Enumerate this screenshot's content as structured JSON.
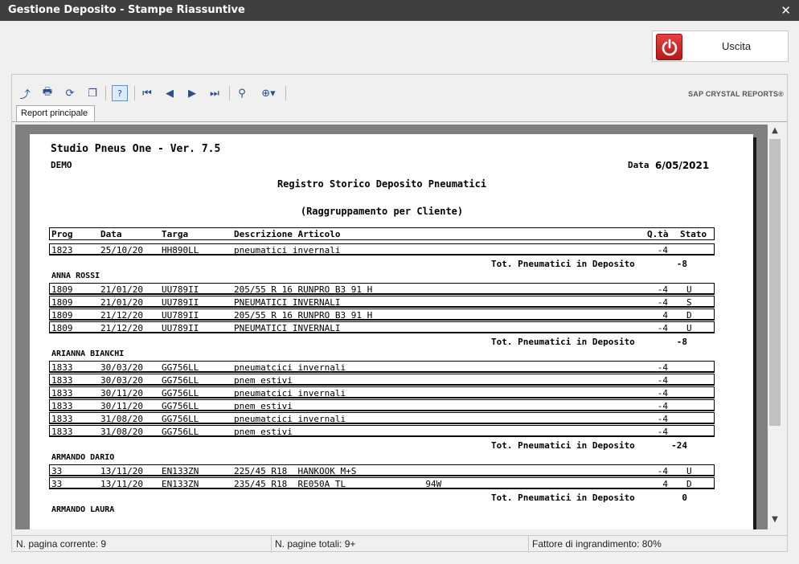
{
  "window": {
    "title": "Gestione Deposito - Stampe Riassuntive",
    "close_glyph": "✕"
  },
  "exit_button": {
    "label": "Uscita",
    "icon": "power-icon",
    "color": "#d42a2a"
  },
  "toolbar": {
    "brand": "SAP CRYSTAL REPORTS®",
    "help_label": "?"
  },
  "tabs": [
    {
      "label": "Report principale"
    }
  ],
  "report": {
    "app_line": "Studio Pneus One - Ver. 7.5",
    "company": "DEMO",
    "date_label": "Data",
    "date_value": "6/05/2021",
    "title": "Registro Storico Deposito Pneumatici",
    "subtitle": "(Raggruppamento per Cliente)",
    "columns": {
      "prog": "Prog",
      "data": "Data",
      "targa": "Targa",
      "descr": "Descrizione Articolo",
      "qta": "Q.tà",
      "stato": "Stato"
    },
    "total_label": "Tot. Pneumatici in Deposito",
    "groups": [
      {
        "name": "",
        "rows": [
          {
            "prog": "1823",
            "data": "25/10/20",
            "targa": "HH890LL",
            "descr": "pneumatici invernali",
            "qta": "-4",
            "stato": ""
          }
        ],
        "total": "-8"
      },
      {
        "name": "ANNA ROSSI",
        "rows": [
          {
            "prog": "1809",
            "data": "21/01/20",
            "targa": "UU789II",
            "descr": "205/55 R 16 RUNPRO B3 91 H",
            "qta": "-4",
            "stato": "U"
          },
          {
            "prog": "1809",
            "data": "21/01/20",
            "targa": "UU789II",
            "descr": "PNEUMATICI INVERNALI",
            "qta": "-4",
            "stato": "S"
          },
          {
            "prog": "1809",
            "data": "21/12/20",
            "targa": "UU789II",
            "descr": "205/55 R 16 RUNPRO B3 91 H",
            "qta": "4",
            "stato": "D"
          },
          {
            "prog": "1809",
            "data": "21/12/20",
            "targa": "UU789II",
            "descr": "PNEUMATICI INVERNALI",
            "qta": "-4",
            "stato": "U"
          }
        ],
        "total": "-8"
      },
      {
        "name": "ARIANNA BIANCHI",
        "rows": [
          {
            "prog": "1833",
            "data": "30/03/20",
            "targa": "GG756LL",
            "descr": "pneumatcici invernali",
            "qta": "-4",
            "stato": ""
          },
          {
            "prog": "1833",
            "data": "30/03/20",
            "targa": "GG756LL",
            "descr": "pnem estivi",
            "qta": "-4",
            "stato": ""
          },
          {
            "prog": "1833",
            "data": "30/11/20",
            "targa": "GG756LL",
            "descr": "pneumatcici invernali",
            "qta": "-4",
            "stato": ""
          },
          {
            "prog": "1833",
            "data": "30/11/20",
            "targa": "GG756LL",
            "descr": "pnem estivi",
            "qta": "-4",
            "stato": ""
          },
          {
            "prog": "1833",
            "data": "31/08/20",
            "targa": "GG756LL",
            "descr": "pneumatcici invernali",
            "qta": "-4",
            "stato": ""
          },
          {
            "prog": "1833",
            "data": "31/08/20",
            "targa": "GG756LL",
            "descr": "pnem estivi",
            "qta": "-4",
            "stato": ""
          }
        ],
        "total": "-24"
      },
      {
        "name": "ARMANDO DARIO",
        "rows": [
          {
            "prog": "33",
            "data": "13/11/20",
            "targa": "EN133ZN",
            "descr": "225/45 R18  HANKOOK M+S",
            "qta": "-4",
            "stato": "U"
          },
          {
            "prog": "33",
            "data": "13/11/20",
            "targa": "EN133ZN",
            "descr": "235/45 R18  RE050A TL               94W",
            "qta": "4",
            "stato": "D"
          }
        ],
        "total": "0"
      },
      {
        "name": "ARMANDO LAURA",
        "rows": [],
        "total": null
      }
    ]
  },
  "status": {
    "current_page": "N. pagina corrente: 9",
    "total_pages": "N. pagine totali: 9+",
    "zoom": "Fattore di ingrandimento: 80%"
  }
}
